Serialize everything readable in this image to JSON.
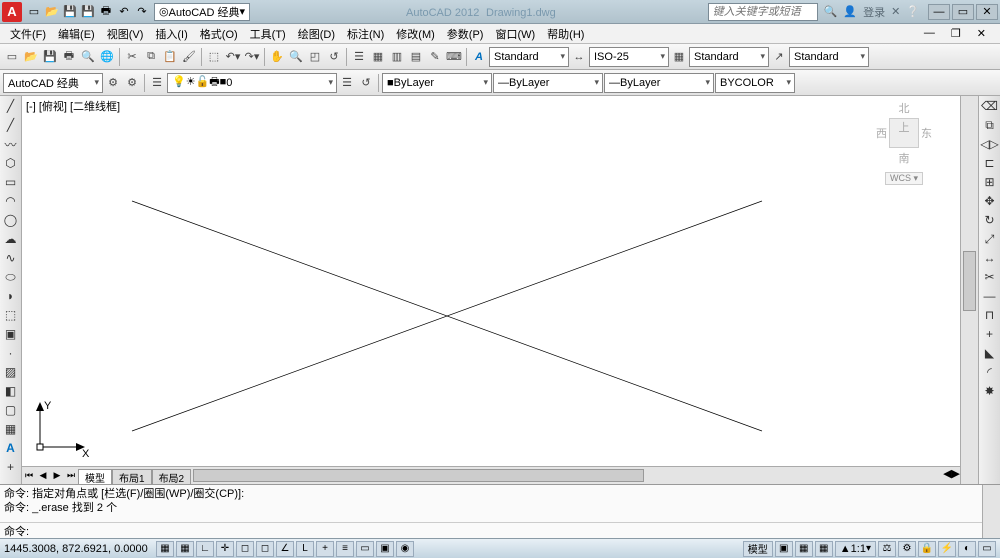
{
  "app": {
    "letter": "A",
    "workspace": "AutoCAD 经典",
    "title_app": "AutoCAD 2012",
    "title_file": "Drawing1.dwg",
    "search_ph": "键入关键字或短语",
    "login": "登录"
  },
  "menu": {
    "items": [
      "文件(F)",
      "编辑(E)",
      "视图(V)",
      "插入(I)",
      "格式(O)",
      "工具(T)",
      "绘图(D)",
      "标注(N)",
      "修改(M)",
      "参数(P)",
      "窗口(W)",
      "帮助(H)"
    ]
  },
  "tb2": {
    "text_style": "Standard",
    "dim_style": "ISO-25",
    "tbl_style": "Standard",
    "ml_style": "Standard"
  },
  "layer": {
    "ws": "AutoCAD 经典",
    "cur": "0",
    "color": "ByLayer",
    "ltype": "ByLayer",
    "lweight": "ByLayer",
    "plot": "BYCOLOR"
  },
  "view": {
    "label": "[-] [俯视] [二维线框]",
    "cube_n": "北",
    "cube_w": "西",
    "cube_top": "上",
    "cube_e": "东",
    "cube_s": "南",
    "wcs": "WCS ▾",
    "ucs_y": "Y",
    "ucs_x": "X"
  },
  "tabs": {
    "model": "模型",
    "l1": "布局1",
    "l2": "布局2"
  },
  "cmd": {
    "line1": "命令: 指定对角点或 [栏选(F)/圈围(WP)/圈交(CP)]:",
    "line2": "命令: _.erase 找到 2 个",
    "prompt": "命令:"
  },
  "status": {
    "coords": "1445.3008, 872.6921, 0.0000",
    "ms": "模型",
    "scale": "1:1",
    "ann": "▲"
  }
}
